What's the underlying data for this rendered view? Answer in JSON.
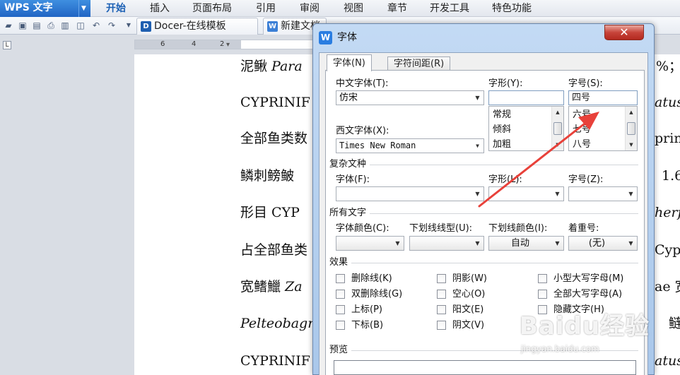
{
  "app": {
    "name": "WPS 文字"
  },
  "menu": {
    "items": [
      "开始",
      "插入",
      "页面布局",
      "引用",
      "审阅",
      "视图",
      "章节",
      "开发工具",
      "特色功能"
    ],
    "active_index": 0
  },
  "tabs": [
    {
      "label": "Docer-在线模板"
    },
    {
      "label": "新建文档"
    }
  ],
  "ruler": {
    "corner": "L",
    "numbers": [
      "6",
      "4",
      "2"
    ]
  },
  "document": {
    "lines": [
      {
        "text": "泥鳅 ",
        "italic": "Para",
        "right": "%；鳅"
      },
      {
        "text": "CYPRINIF",
        "italic": "",
        "right": "atus"
      },
      {
        "text": "全部鱼类数",
        "italic": "",
        "right": "prin"
      },
      {
        "text": "鳞刺鳑鲏 ",
        "italic": "",
        "right": "1.6"
      },
      {
        "text": "形目 CYP",
        "italic": "",
        "right": "herf"
      },
      {
        "text": "占全部鱼类",
        "italic": "",
        "right": "Cyp"
      },
      {
        "text": "宽鳍鱲 ",
        "italic": "Za",
        "right": "ae 宽"
      },
      {
        "text": "",
        "italic": "Pelteobagr",
        "right": "鲢"
      },
      {
        "text": "CYPRINIF",
        "italic": "",
        "right": "atus"
      }
    ]
  },
  "dialog": {
    "title": "字体",
    "close": "✕",
    "tabs": [
      "字体(N)",
      "字符间距(R)"
    ],
    "chinese_font": {
      "label": "中文字体(T):",
      "value": "仿宋"
    },
    "style": {
      "label": "字形(Y):",
      "value": "",
      "options": [
        "常规",
        "倾斜",
        "加粗"
      ]
    },
    "size": {
      "label": "字号(S):",
      "value": "四号",
      "options": [
        "六号",
        "七号",
        "八号"
      ]
    },
    "western_font": {
      "label": "西文字体(X):",
      "value": "Times New Roman"
    },
    "complex": {
      "section": "复杂文种",
      "font_label": "字体(F):",
      "style_label": "字形(L):",
      "size_label": "字号(Z):"
    },
    "all_text": {
      "section": "所有文字",
      "color_label": "字体颜色(C):",
      "underline_label": "下划线线型(U):",
      "underline_color_label": "下划线颜色(I):",
      "underline_color_value": "自动",
      "emphasis_label": "着重号:",
      "emphasis_value": "(无)"
    },
    "effects": {
      "section": "效果",
      "items": [
        "删除线(K)",
        "双删除线(G)",
        "上标(P)",
        "下标(B)",
        "阴影(W)",
        "空心(O)",
        "阳文(E)",
        "阴文(V)",
        "小型大写字母(M)",
        "全部大写字母(A)",
        "隐藏文字(H)"
      ]
    },
    "preview": {
      "section": "预览"
    }
  },
  "watermark": {
    "logo": "Baidu经验",
    "sub": "jingyan.baidu.com"
  },
  "colors": {
    "accent": "#2165c4",
    "arrow": "#e8413a",
    "close": "#c7443a"
  }
}
